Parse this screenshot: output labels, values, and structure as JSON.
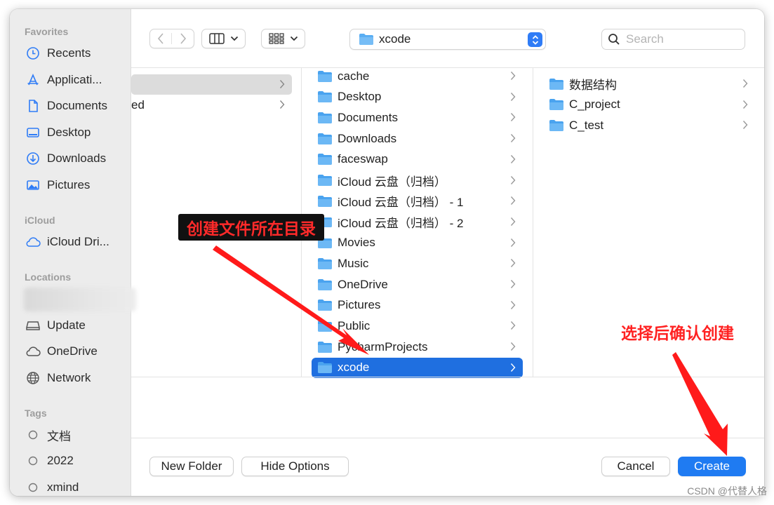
{
  "sidebar": {
    "favorites_header": "Favorites",
    "favorites": [
      {
        "label": "Recents",
        "icon": "clock-icon"
      },
      {
        "label": "Applicati...",
        "icon": "applications-icon"
      },
      {
        "label": "Documents",
        "icon": "document-icon"
      },
      {
        "label": "Desktop",
        "icon": "desktop-icon"
      },
      {
        "label": "Downloads",
        "icon": "download-icon"
      },
      {
        "label": "Pictures",
        "icon": "pictures-icon"
      }
    ],
    "icloud_header": "iCloud",
    "icloud": [
      {
        "label": "iCloud Dri...",
        "icon": "cloud-icon"
      }
    ],
    "locations_header": "Locations",
    "locations": [
      {
        "label": "Update",
        "icon": "drive-icon"
      },
      {
        "label": "OneDrive",
        "icon": "cloud-icon"
      },
      {
        "label": "Network",
        "icon": "globe-icon"
      }
    ],
    "tags_header": "Tags",
    "tags": [
      {
        "label": "文档"
      },
      {
        "label": "2022"
      },
      {
        "label": "xmind"
      }
    ]
  },
  "toolbar": {
    "path_value": "xcode",
    "search_placeholder": "Search"
  },
  "columns": {
    "col1": [
      {
        "label": "",
        "selected_gray": true
      },
      {
        "label": "ed",
        "selected_gray": false
      }
    ],
    "col2": [
      {
        "label": "cache"
      },
      {
        "label": "Desktop"
      },
      {
        "label": "Documents"
      },
      {
        "label": "Downloads"
      },
      {
        "label": "faceswap"
      },
      {
        "label": "iCloud 云盘（归档）"
      },
      {
        "label": "iCloud 云盘（归档） - 1"
      },
      {
        "label": "iCloud 云盘（归档） - 2"
      },
      {
        "label": "Movies"
      },
      {
        "label": "Music"
      },
      {
        "label": "OneDrive"
      },
      {
        "label": "Pictures"
      },
      {
        "label": "Public"
      },
      {
        "label": "PycharmProjects"
      },
      {
        "label": "xcode",
        "selected": true
      }
    ],
    "col3": [
      {
        "label": "数据结构"
      },
      {
        "label": "C_project"
      },
      {
        "label": "C_test"
      }
    ]
  },
  "buttons": {
    "new_folder": "New Folder",
    "hide_options": "Hide Options",
    "cancel": "Cancel",
    "create": "Create"
  },
  "annotations": {
    "box_text": "创建文件所在目录",
    "right_text": "选择后确认创建",
    "color": "#ff2222"
  },
  "watermark": "CSDN @代替人格",
  "colors": {
    "accent": "#1f6fe0",
    "folder": "#5aaef3",
    "sidebar_bg": "#ececec"
  }
}
